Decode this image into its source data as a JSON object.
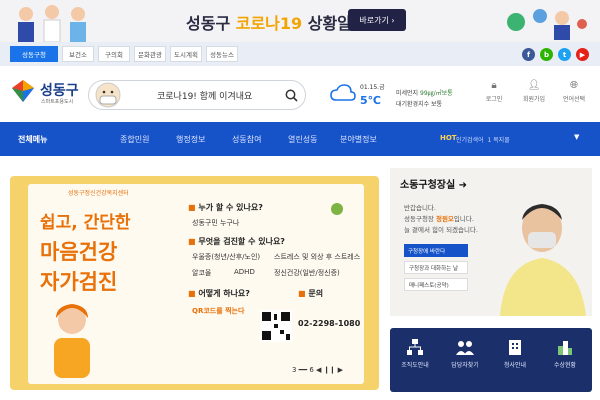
{
  "banner": {
    "prefix": "성동구 ",
    "highlight": "코로나19",
    "suffix": " 상황알림",
    "button": "바로가기"
  },
  "site_tabs": [
    "성동구청",
    "보건소",
    "구의회",
    "문화관광",
    "도시계획",
    "성동뉴스"
  ],
  "sns": [
    "f",
    "b",
    "t",
    "▶"
  ],
  "header": {
    "logo": "성동구",
    "logo_sub": "스마트포용도시",
    "search_placeholder": "코로나19! 함께 이겨내요"
  },
  "weather": {
    "date": "01.15.금",
    "temp": "5℃",
    "dust_label": "미세먼지 ",
    "dust_value": "99㎍/㎥보통",
    "aqi": "대기환경지수 보통"
  },
  "utils": [
    {
      "icon": "lock-icon",
      "label": "로그인"
    },
    {
      "icon": "user-icon",
      "label": "회원가입"
    },
    {
      "icon": "globe-icon",
      "label": "언어선택"
    }
  ],
  "nav": {
    "all": "전체메뉴",
    "items": [
      "종합민원",
      "행정정보",
      "성동참여",
      "열린성동",
      "분야별정보"
    ],
    "hot_label": "HOT",
    "hot_text": "인기검색어",
    "hot_top": "1 복지몰"
  },
  "card": {
    "org": "성동구정신건강복지센터",
    "title1": "쉽고, 간단한",
    "title2": "마음건강",
    "title3": "자가검진",
    "q1": "누가 할 수 있나요?",
    "a1": "성동구민 누구나",
    "q2": "무엇을 검진할 수 있나요?",
    "a2a": "우울증(청년/산후/노인)",
    "a2b": "스트레스 및 외상 후 스트레스",
    "a2c": "알코올",
    "a2d": "ADHD",
    "a2e": "정신건강(일반/정신증)",
    "q3": "어떻게 하나요?",
    "a3": "QR코드를 찍는다",
    "q4": "문의",
    "phone": "02-2298-1080",
    "pager": "3 ━━ 6   ◀  ❙❙  ▶"
  },
  "mayor": {
    "title": "소동구청장실",
    "greet1": "반갑습니다.",
    "greet2_pre": "성동구청장 ",
    "greet2_name": "정원오",
    "greet2_post": "입니다.",
    "greet3": "늘 곁에서 힘이 되겠습니다.",
    "btn1": "구청장에 바란다",
    "btn2": "구청장과 대화하는 날",
    "btn3": "매니페스토(공약)"
  },
  "quick": [
    "조직도안내",
    "담당자찾기",
    "청사안내",
    "수상현황"
  ],
  "colors": {
    "nav": "#1652c8",
    "accent": "#e8710a",
    "banner_hl": "#f2a400",
    "quick_bg": "#1b2f6a"
  }
}
